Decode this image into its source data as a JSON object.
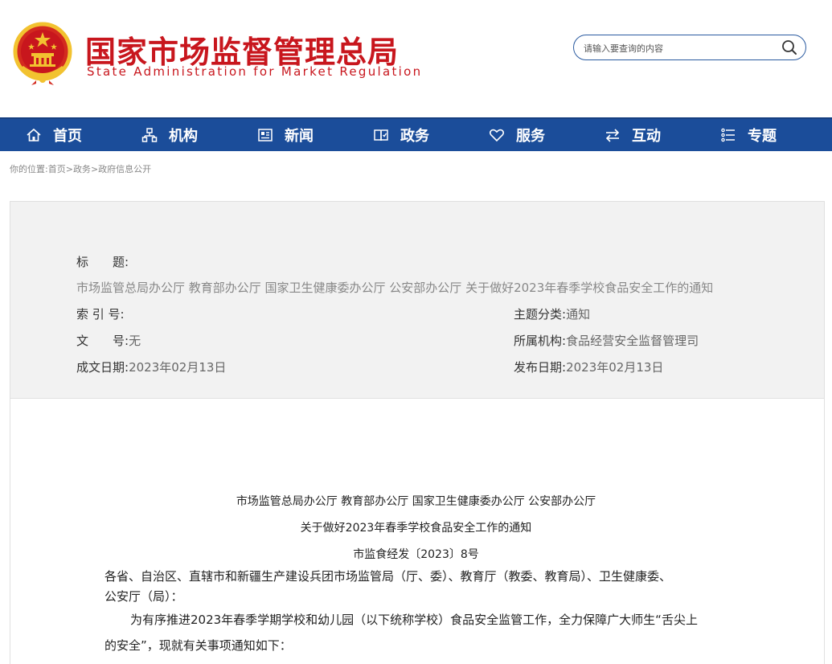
{
  "header": {
    "site_name": "国家市场监督管理总局",
    "site_name_en": "State Administration for Market Regulation",
    "search_placeholder": "请输入要查询的内容"
  },
  "nav": {
    "items": [
      {
        "label": "首页",
        "icon": "home-icon"
      },
      {
        "label": "机构",
        "icon": "org-chart-icon"
      },
      {
        "label": "新闻",
        "icon": "news-icon"
      },
      {
        "label": "政务",
        "icon": "book-icon"
      },
      {
        "label": "服务",
        "icon": "heart-icon"
      },
      {
        "label": "互动",
        "icon": "exchange-icon"
      },
      {
        "label": "专题",
        "icon": "list-icon"
      }
    ]
  },
  "breadcrumb": {
    "prefix": "你的位置:",
    "items": [
      "首页",
      "政务",
      "政府信息公开"
    ],
    "sep": ">"
  },
  "meta": {
    "title_label": "标　　题:",
    "title_value": "市场监管总局办公厅 教育部办公厅 国家卫生健康委办公厅 公安部办公厅 关于做好2023年春季学校食品安全工作的通知",
    "index_label": "索 引 号:",
    "index_value": "",
    "doc_no_label": "文　　号:",
    "doc_no_value": "无",
    "created_label": "成文日期:",
    "created_value": "2023年02月13日",
    "topic_label": "主题分类:",
    "topic_value": "通知",
    "agency_label": "所属机构:",
    "agency_value": "食品经营安全监督管理司",
    "published_label": "发布日期:",
    "published_value": "2023年02月13日"
  },
  "doc": {
    "issuers": "市场监管总局办公厅 教育部办公厅 国家卫生健康委办公厅 公安部办公厅",
    "title": "关于做好2023年春季学校食品安全工作的通知",
    "number": "市监食经发〔2023〕8号",
    "recipients_line1": "各省、自治区、直辖市和新疆生产建设兵团市场监管局（厅、委）、教育厅（教委、教育局）、卫生健康委、",
    "recipients_line2": "公安厅（局）：",
    "body_line1": "为有序推进2023年春季学期学校和幼儿园（以下统称学校）食品安全监管工作，全力保障广大师生“舌尖上",
    "body_line2": "的安全”，现就有关事项通知如下："
  },
  "colors": {
    "brand_red": "#c8161d",
    "nav_blue": "#1b4d9a",
    "gold": "#f2c230"
  }
}
